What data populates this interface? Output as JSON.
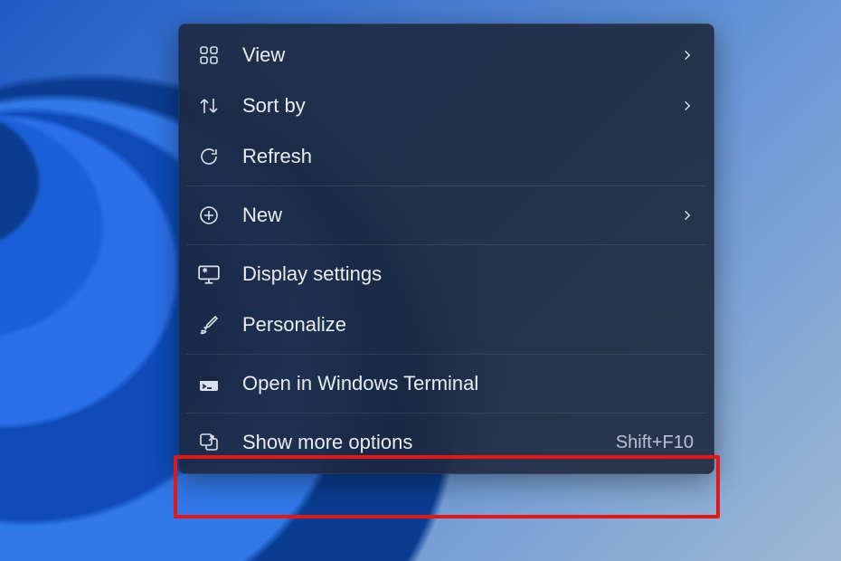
{
  "contextMenu": {
    "items": [
      {
        "label": "View",
        "hasSubmenu": true
      },
      {
        "label": "Sort by",
        "hasSubmenu": true
      },
      {
        "label": "Refresh",
        "hasSubmenu": false
      },
      {
        "label": "New",
        "hasSubmenu": true
      },
      {
        "label": "Display settings",
        "hasSubmenu": false
      },
      {
        "label": "Personalize",
        "hasSubmenu": false
      },
      {
        "label": "Open in Windows Terminal",
        "hasSubmenu": false
      },
      {
        "label": "Show more options",
        "hasSubmenu": false,
        "shortcut": "Shift+F10"
      }
    ]
  }
}
